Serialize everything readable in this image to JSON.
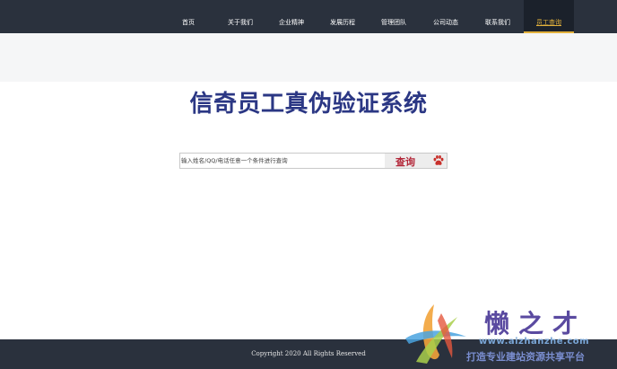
{
  "nav": {
    "items": [
      {
        "label": "首页"
      },
      {
        "label": "关于我们"
      },
      {
        "label": "企业精神"
      },
      {
        "label": "发展历程"
      },
      {
        "label": "管理团队"
      },
      {
        "label": "公司动态"
      },
      {
        "label": "联系我们"
      },
      {
        "label": "员工查询"
      }
    ],
    "active_label": "员工查询"
  },
  "main": {
    "title": "信奇员工真伪验证系统"
  },
  "search": {
    "placeholder": "输入姓名/QQ/电话任意一个条件进行查询",
    "button_label": "查询",
    "button_icon": "paw-icon"
  },
  "footer": {
    "copyright": "Copyright 2020 All Rights Reserved"
  },
  "watermark": {
    "brand": "懒之才",
    "url": "www.aizhanzhe.com",
    "slogan": "打造专业建站资源共享平台"
  },
  "colors": {
    "nav_background": "#2a313d",
    "active_accent": "#e2b13c",
    "title": "#2b3784",
    "search_button_text": "#b3283a"
  }
}
